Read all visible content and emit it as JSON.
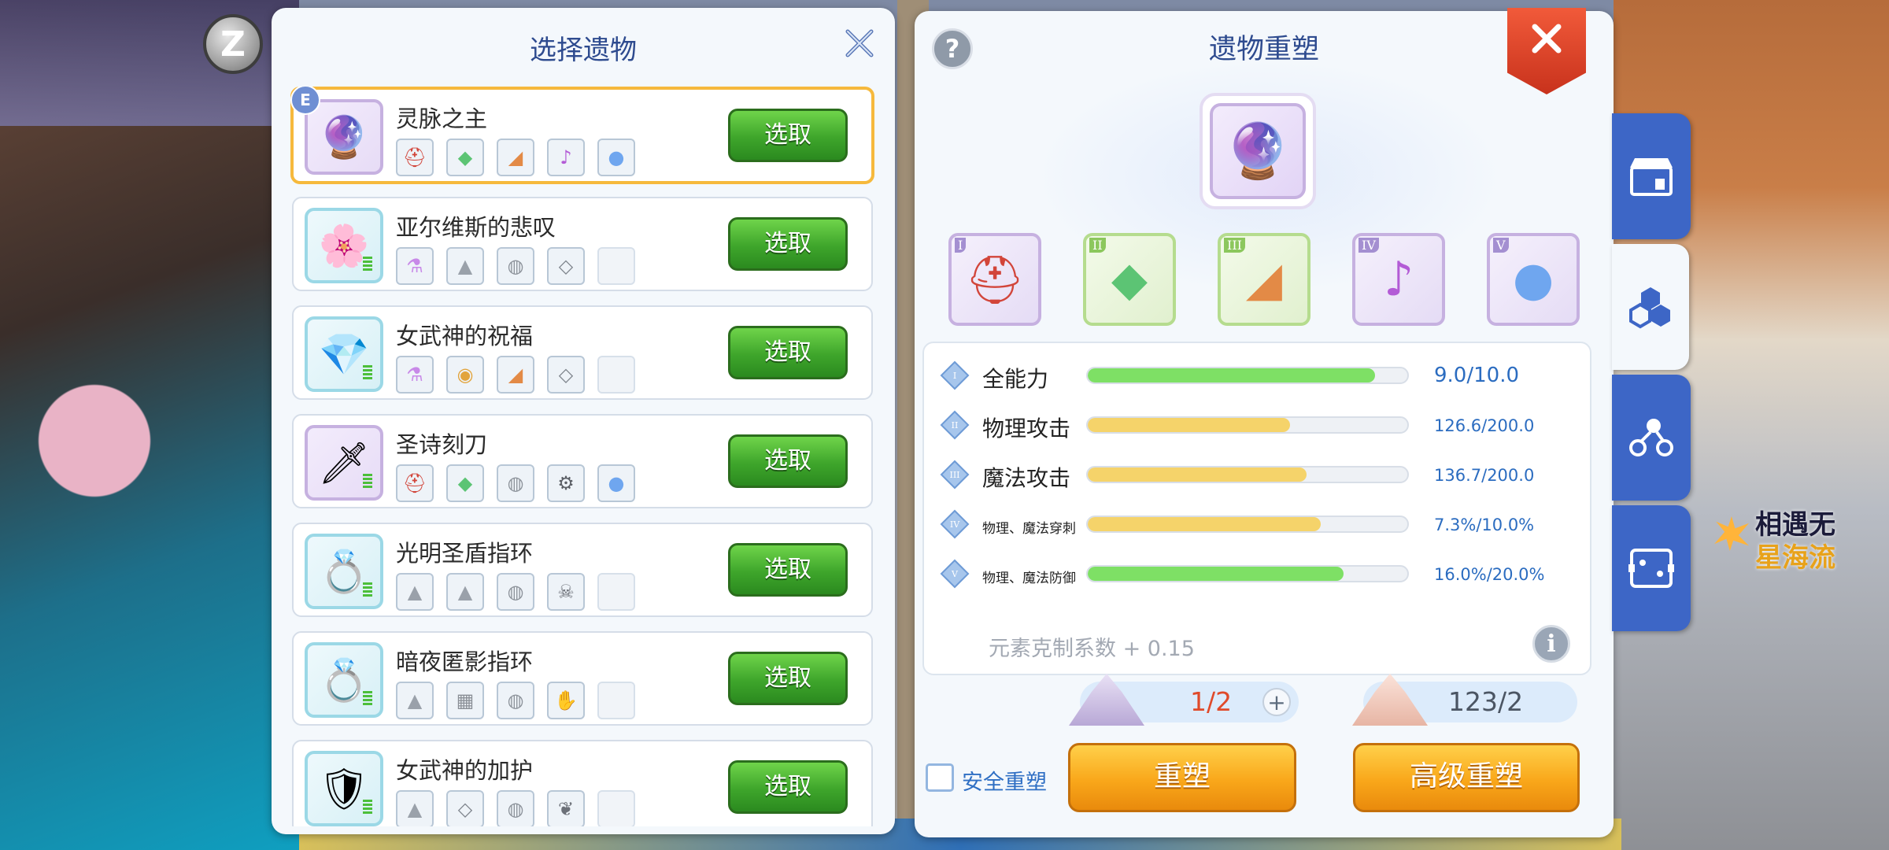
{
  "hud": {
    "z_badge": "Z"
  },
  "floating_text": {
    "line1": "相遇无",
    "line2": "星海流"
  },
  "select_panel": {
    "title": "选择遗物",
    "pick_label": "选取",
    "selected_badge": "E",
    "relics": [
      {
        "name": "灵脉之主",
        "icon": "staff-icon",
        "selected": true,
        "materials": [
          "helmet-icon",
          "crystal-icon",
          "shard-icon",
          "horn-icon",
          "egg-icon"
        ]
      },
      {
        "name": "亚尔维斯的悲叹",
        "icon": "flower-relic-icon",
        "selected": false,
        "materials": [
          "potion-icon",
          "sand-icon",
          "stone-icon",
          "ore-icon",
          "empty"
        ]
      },
      {
        "name": "女武神的祝福",
        "icon": "winged-gem-icon",
        "selected": false,
        "materials": [
          "potion-icon",
          "nugget-icon",
          "shard-icon",
          "ore-icon",
          "empty"
        ]
      },
      {
        "name": "圣诗刻刀",
        "icon": "dagger-icon",
        "selected": false,
        "materials": [
          "helmet-icon",
          "crystal-icon",
          "stone-icon",
          "gear-icon",
          "egg-icon"
        ]
      },
      {
        "name": "光明圣盾指环",
        "icon": "ring-icon",
        "selected": false,
        "materials": [
          "sand-icon",
          "sand-icon",
          "stone-icon",
          "skull-icon",
          "empty"
        ]
      },
      {
        "name": "暗夜匿影指环",
        "icon": "ring-icon",
        "selected": false,
        "materials": [
          "sand-icon",
          "brick-icon",
          "stone-icon",
          "claw-icon",
          "empty"
        ]
      },
      {
        "name": "女武神的加护",
        "icon": "shield-icon",
        "selected": false,
        "materials": [
          "sand-icon",
          "ore-icon",
          "stone-icon",
          "feather-icon",
          "empty"
        ]
      }
    ]
  },
  "reforge_panel": {
    "title": "遗物重塑",
    "help": "?",
    "slots": [
      {
        "num": "I",
        "icon": "helmet-icon",
        "tone": "purple"
      },
      {
        "num": "II",
        "icon": "crystal-icon",
        "tone": "green"
      },
      {
        "num": "III",
        "icon": "shard-icon",
        "tone": "green"
      },
      {
        "num": "IV",
        "icon": "horn-icon",
        "tone": "purple"
      },
      {
        "num": "V",
        "icon": "egg-icon",
        "tone": "purple"
      }
    ],
    "stats": [
      {
        "num": "I",
        "name": "全能力",
        "value": "9.0/10.0",
        "progress": 0.9,
        "color": "#7ee065",
        "small": false
      },
      {
        "num": "II",
        "name": "物理攻击",
        "value": "126.6/200.0",
        "progress": 0.633,
        "color": "#f5d36a",
        "small": false
      },
      {
        "num": "III",
        "name": "魔法攻击",
        "value": "136.7/200.0",
        "progress": 0.684,
        "color": "#f5d36a",
        "small": false
      },
      {
        "num": "IV",
        "name": "物理、魔法穿刺",
        "value": "7.3%/10.0%",
        "progress": 0.73,
        "color": "#f5d36a",
        "small": true
      },
      {
        "num": "V",
        "name": "物理、魔法防御",
        "value": "16.0%/20.0%",
        "progress": 0.8,
        "color": "#7ee065",
        "small": true
      }
    ],
    "element_text": "元素克制系数 + 0.15",
    "info": "i",
    "cost1": {
      "text": "1/2",
      "color": "#e04a2a"
    },
    "cost2": {
      "text": "123/2",
      "color": "#4b5563"
    },
    "plus": "+",
    "safe_label": "安全重塑",
    "reforge_label": "重塑",
    "advanced_label": "高级重塑"
  },
  "colors": {
    "accent": "#2e4b8f",
    "green_button": "#3ea52b",
    "orange_button": "#f9a71a",
    "tab_blue": "#3d66c6"
  }
}
